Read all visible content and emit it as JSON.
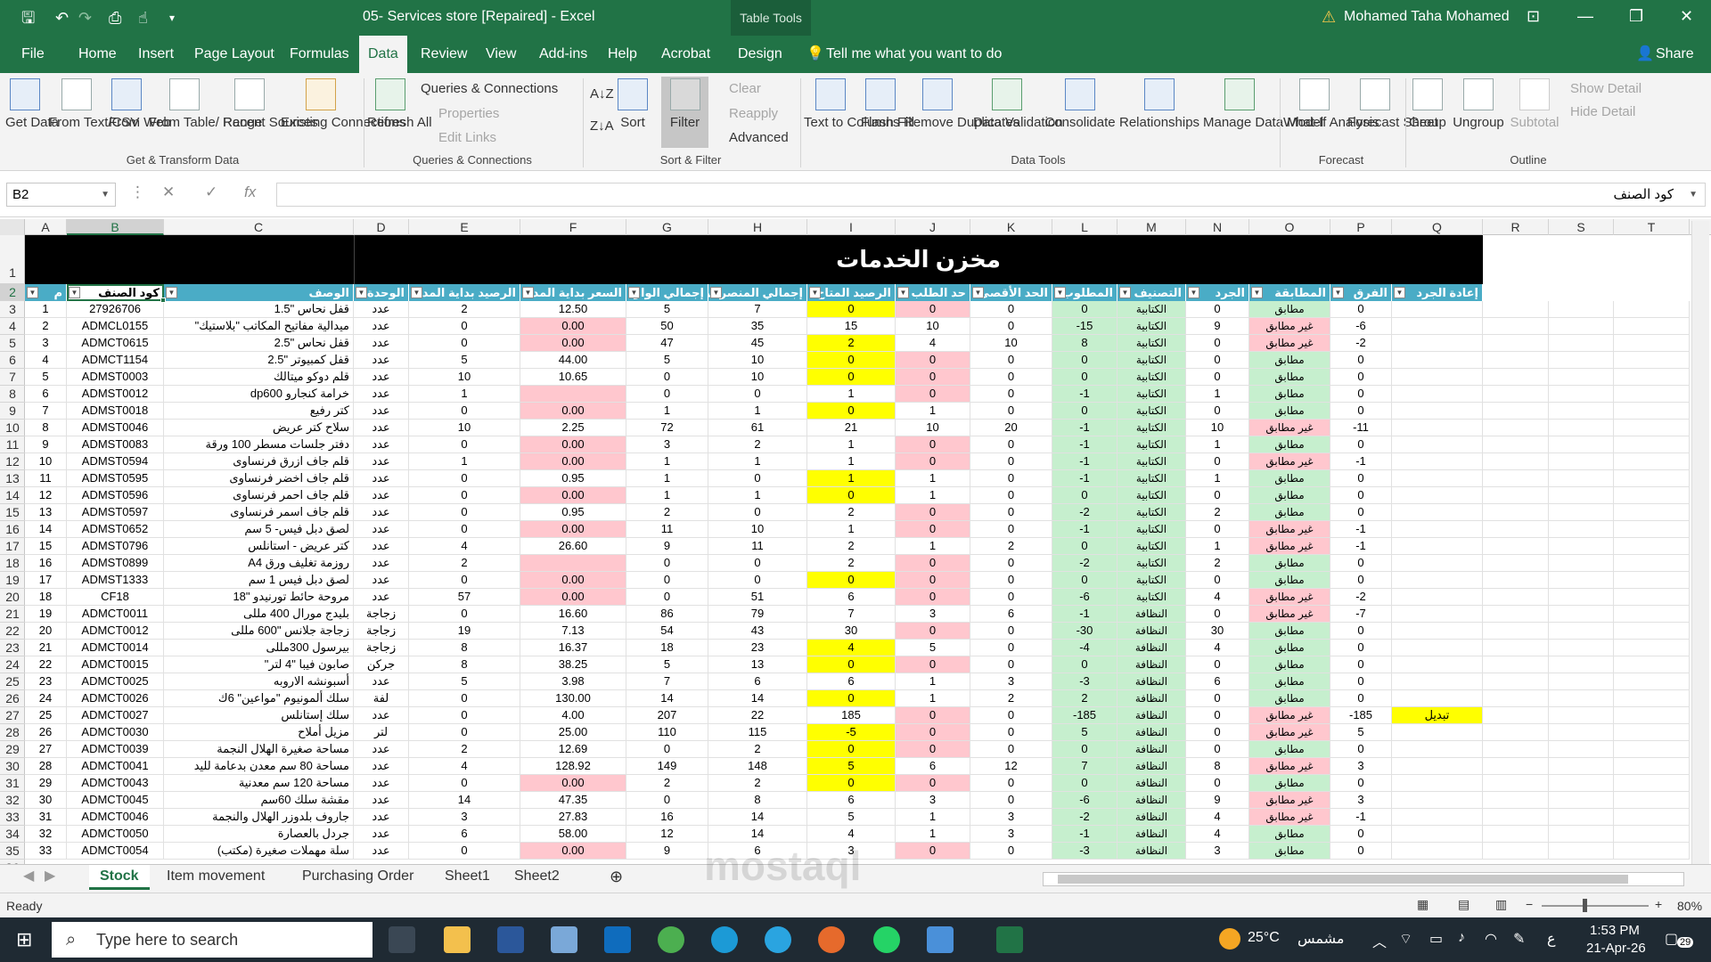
{
  "title_bar": {
    "file_title": "05- Services store [Repaired]  -  Excel",
    "table_tools": "Table Tools",
    "user": "Mohamed Taha Mohamed"
  },
  "menu_tabs": [
    "File",
    "Home",
    "Insert",
    "Page Layout",
    "Formulas",
    "Data",
    "Review",
    "View",
    "Add-ins",
    "Help",
    "Acrobat",
    "Design"
  ],
  "tell_me": "Tell me what you want to do",
  "share": "Share",
  "ribbon": {
    "get_data": "Get Data",
    "from_text": "From Text/CSV",
    "from_web": "From Web",
    "from_table": "From Table/ Range",
    "recent_sources": "Recent Sources",
    "existing_connections": "Existing Connections",
    "group_get": "Get & Transform Data",
    "refresh_all": "Refresh All",
    "queries_connections": "Queries & Connections",
    "properties": "Properties",
    "edit_links": "Edit Links",
    "group_queries": "Queries & Connections",
    "sort": "Sort",
    "filter": "Filter",
    "clear": "Clear",
    "reapply": "Reapply",
    "advanced": "Advanced",
    "group_sort": "Sort & Filter",
    "text_to_columns": "Text to Columns",
    "flash_fill": "Flash Fill",
    "remove_duplicates": "Remove Duplicates",
    "data_validation": "Data Validation",
    "consolidate": "Consolidate",
    "relationships": "Relationships",
    "manage_data_model": "Manage Data Model",
    "group_data_tools": "Data Tools",
    "what_if": "What-If Analysis",
    "forecast_sheet": "Forecast Sheet",
    "group_forecast": "Forecast",
    "group": "Group",
    "ungroup": "Ungroup",
    "subtotal": "Subtotal",
    "show_detail": "Show Detail",
    "hide_detail": "Hide Detail",
    "group_outline": "Outline"
  },
  "formula_bar": {
    "name_box": "B2",
    "content": "كود الصنف"
  },
  "columns": [
    "A",
    "B",
    "C",
    "D",
    "E",
    "F",
    "G",
    "H",
    "I",
    "J",
    "K",
    "L",
    "M",
    "N",
    "O",
    "P",
    "Q",
    "R",
    "S",
    "T"
  ],
  "banner_title": "مخزن الخدمات",
  "headers": [
    "م",
    "كود الصنف",
    "الوصف",
    "الوحدة",
    "الرصيد بداية المدة",
    "السعر بداية المدة",
    "إجمالي الوارد",
    "إجمالي المنصرف",
    "الرصيد المتاح",
    "حد الطلب",
    "الحد الأقصى",
    "المطلوب",
    "التصنيف",
    "الجرد",
    "المطابقة",
    "الفرق",
    "إعادة الجرد"
  ],
  "rows": [
    [
      "1",
      "27926706",
      "قفل نحاس \"1.5",
      "عدد",
      "2",
      "12.50",
      "5",
      "7",
      "0",
      "0",
      "0",
      "0",
      "الكتابية",
      "0",
      "مطابق",
      "0",
      ""
    ],
    [
      "2",
      "ADMCL0155",
      "ميدالية مفاتيح المكاتب \"بلاستيك\"",
      "عدد",
      "0",
      "0.00",
      "50",
      "35",
      "15",
      "10",
      "0",
      "-15",
      "الكتابية",
      "9",
      "غير مطابق",
      "-6",
      ""
    ],
    [
      "3",
      "ADMCT0615",
      "قفل نحاس \"2.5",
      "عدد",
      "0",
      "0.00",
      "47",
      "45",
      "2",
      "4",
      "10",
      "8",
      "الكتابية",
      "0",
      "غير مطابق",
      "-2",
      ""
    ],
    [
      "4",
      "ADMCT1154",
      "قفل كمبيوتر \"2.5",
      "عدد",
      "5",
      "44.00",
      "5",
      "10",
      "0",
      "0",
      "0",
      "0",
      "الكتابية",
      "0",
      "مطابق",
      "0",
      ""
    ],
    [
      "5",
      "ADMST0003",
      "قلم دوكو ميتالك",
      "عدد",
      "10",
      "10.65",
      "0",
      "10",
      "0",
      "0",
      "0",
      "0",
      "الكتابية",
      "0",
      "مطابق",
      "0",
      ""
    ],
    [
      "6",
      "ADMST0012",
      "خرامة كنجارو dp600",
      "عدد",
      "1",
      "",
      "0",
      "0",
      "1",
      "0",
      "0",
      "-1",
      "الكتابية",
      "1",
      "مطابق",
      "0",
      ""
    ],
    [
      "7",
      "ADMST0018",
      "كتر رفيع",
      "عدد",
      "0",
      "0.00",
      "1",
      "1",
      "0",
      "1",
      "0",
      "0",
      "الكتابية",
      "0",
      "مطابق",
      "0",
      ""
    ],
    [
      "8",
      "ADMST0046",
      "سلاح كتر عريض",
      "عدد",
      "10",
      "2.25",
      "72",
      "61",
      "21",
      "10",
      "20",
      "-1",
      "الكتابية",
      "10",
      "غير مطابق",
      "-11",
      ""
    ],
    [
      "9",
      "ADMST0083",
      "دفتر جلسات مسطر 100 ورقة",
      "عدد",
      "0",
      "0.00",
      "3",
      "2",
      "1",
      "0",
      "0",
      "-1",
      "الكتابية",
      "1",
      "مطابق",
      "0",
      ""
    ],
    [
      "10",
      "ADMST0594",
      "قلم جاف ازرق  فرنساوى",
      "عدد",
      "1",
      "0.00",
      "1",
      "1",
      "1",
      "0",
      "0",
      "-1",
      "الكتابية",
      "0",
      "غير مطابق",
      "-1",
      ""
    ],
    [
      "11",
      "ADMST0595",
      "قلم جاف اخضر فرنساوى",
      "عدد",
      "0",
      "0.95",
      "1",
      "0",
      "1",
      "1",
      "0",
      "-1",
      "الكتابية",
      "1",
      "مطابق",
      "0",
      ""
    ],
    [
      "12",
      "ADMST0596",
      "قلم جاف احمر فرنساوى",
      "عدد",
      "0",
      "0.00",
      "1",
      "1",
      "0",
      "1",
      "0",
      "0",
      "الكتابية",
      "0",
      "مطابق",
      "0",
      ""
    ],
    [
      "13",
      "ADMST0597",
      "قلم جاف اسمر فرنساوى",
      "عدد",
      "0",
      "0.95",
      "2",
      "0",
      "2",
      "0",
      "0",
      "-2",
      "الكتابية",
      "2",
      "مطابق",
      "0",
      ""
    ],
    [
      "14",
      "ADMST0652",
      "لصق دبل فيس- 5 سم",
      "عدد",
      "0",
      "0.00",
      "11",
      "10",
      "1",
      "0",
      "0",
      "-1",
      "الكتابية",
      "0",
      "غير مطابق",
      "-1",
      ""
    ],
    [
      "15",
      "ADMST0796",
      "كتر عريض - استانلس",
      "عدد",
      "4",
      "26.60",
      "9",
      "11",
      "2",
      "1",
      "2",
      "0",
      "الكتابية",
      "1",
      "غير مطابق",
      "-1",
      ""
    ],
    [
      "16",
      "ADMST0899",
      "روزمة تغليف ورق A4",
      "عدد",
      "2",
      "",
      "0",
      "0",
      "2",
      "0",
      "0",
      "-2",
      "الكتابية",
      "2",
      "مطابق",
      "0",
      ""
    ],
    [
      "17",
      "ADMST1333",
      "لصق دبل فيس 1 سم",
      "عدد",
      "0",
      "0.00",
      "0",
      "0",
      "0",
      "0",
      "0",
      "0",
      "الكتابية",
      "0",
      "مطابق",
      "0",
      ""
    ],
    [
      "18",
      "CF18",
      "مروحة حائط تورنيدو \"18",
      "عدد",
      "57",
      "0.00",
      "0",
      "51",
      "6",
      "0",
      "0",
      "-6",
      "الكتابية",
      "4",
      "غير مطابق",
      "-2",
      ""
    ],
    [
      "19",
      "ADMCT0011",
      "بليدج مورال 400 مللى",
      "زجاجة",
      "0",
      "16.60",
      "86",
      "79",
      "7",
      "3",
      "6",
      "-1",
      "النظافة",
      "0",
      "غير مطابق",
      "-7",
      ""
    ],
    [
      "20",
      "ADMCT0012",
      "زجاجة جلانس \"600 مللى",
      "زجاجة",
      "19",
      "7.13",
      "54",
      "43",
      "30",
      "0",
      "0",
      "-30",
      "النظافة",
      "30",
      "مطابق",
      "0",
      ""
    ],
    [
      "21",
      "ADMCT0014",
      "بيرسول 300مللى",
      "زجاجة",
      "8",
      "16.37",
      "18",
      "23",
      "4",
      "5",
      "0",
      "-4",
      "النظافة",
      "4",
      "مطابق",
      "0",
      ""
    ],
    [
      "22",
      "ADMCT0015",
      "صابون فيبا \"4 لتر\"",
      "جركن",
      "8",
      "38.25",
      "5",
      "13",
      "0",
      "0",
      "0",
      "0",
      "النظافة",
      "0",
      "مطابق",
      "0",
      ""
    ],
    [
      "23",
      "ADMCT0025",
      "أسبونشه الاروبه",
      "عدد",
      "5",
      "3.98",
      "7",
      "6",
      "6",
      "1",
      "3",
      "-3",
      "النظافة",
      "6",
      "مطابق",
      "0",
      ""
    ],
    [
      "24",
      "ADMCT0026",
      "سلك ألمونيوم \"مواعين\" 6ك",
      "لفة",
      "0",
      "130.00",
      "14",
      "14",
      "0",
      "1",
      "2",
      "2",
      "النظافة",
      "0",
      "مطابق",
      "0",
      ""
    ],
    [
      "25",
      "ADMCT0027",
      "سلك إستانلس",
      "عدد",
      "0",
      "4.00",
      "207",
      "22",
      "185",
      "0",
      "0",
      "-185",
      "النظافة",
      "0",
      "غير مطابق",
      "-185",
      "تبديل"
    ],
    [
      "26",
      "ADMCT0030",
      "مزيل أملاح",
      "لتر",
      "0",
      "25.00",
      "110",
      "115",
      "-5",
      "0",
      "0",
      "5",
      "النظافة",
      "0",
      "غير مطابق",
      "5",
      ""
    ],
    [
      "27",
      "ADMCT0039",
      "مساحة صغيرة الهلال النجمة",
      "عدد",
      "2",
      "12.69",
      "0",
      "2",
      "0",
      "0",
      "0",
      "0",
      "النظافة",
      "0",
      "مطابق",
      "0",
      ""
    ],
    [
      "28",
      "ADMCT0041",
      "مساحة 80 سم معدن بدعامة لليد",
      "عدد",
      "4",
      "128.92",
      "149",
      "148",
      "5",
      "6",
      "12",
      "7",
      "النظافة",
      "8",
      "غير مطابق",
      "3",
      ""
    ],
    [
      "29",
      "ADMCT0043",
      "مساحة 120 سم معدنية",
      "عدد",
      "0",
      "0.00",
      "2",
      "2",
      "0",
      "0",
      "0",
      "0",
      "النظافة",
      "0",
      "مطابق",
      "0",
      ""
    ],
    [
      "30",
      "ADMCT0045",
      "مقشة سلك 60سم",
      "عدد",
      "14",
      "47.35",
      "0",
      "8",
      "6",
      "3",
      "0",
      "-6",
      "النظافة",
      "9",
      "غير مطابق",
      "3",
      ""
    ],
    [
      "31",
      "ADMCT0046",
      "جاروف بلدوزر الهلال والنجمة",
      "عدد",
      "3",
      "27.83",
      "16",
      "14",
      "5",
      "1",
      "3",
      "-2",
      "النظافة",
      "4",
      "غير مطابق",
      "-1",
      ""
    ],
    [
      "32",
      "ADMCT0050",
      "جردل بالعصارة",
      "عدد",
      "6",
      "58.00",
      "12",
      "14",
      "4",
      "1",
      "3",
      "-1",
      "النظافة",
      "4",
      "مطابق",
      "0",
      ""
    ],
    [
      "33",
      "ADMCT0054",
      "سلة مهملات صغيرة (مكتب)",
      "عدد",
      "0",
      "0.00",
      "9",
      "6",
      "3",
      "0",
      "0",
      "-3",
      "النظافة",
      "3",
      "مطابق",
      "0",
      ""
    ]
  ],
  "sheet_tabs": [
    "Stock",
    "Item movement",
    "Purchasing Order",
    "Sheet1",
    "Sheet2"
  ],
  "status": {
    "ready": "Ready",
    "zoom": "80%"
  },
  "taskbar": {
    "search": "Type here to search",
    "weather": "25°C",
    "weather_text": "مشمس",
    "time": "1:53 PM",
    "date": "21-Apr-26",
    "lang": "ع",
    "notif": "29"
  },
  "colors": {
    "excel_green": "#217346",
    "header_teal": "#4aacc6",
    "match_green": "#c6efce",
    "mismatch_red": "#ffc7ce",
    "highlight_yellow": "#ffff00"
  }
}
